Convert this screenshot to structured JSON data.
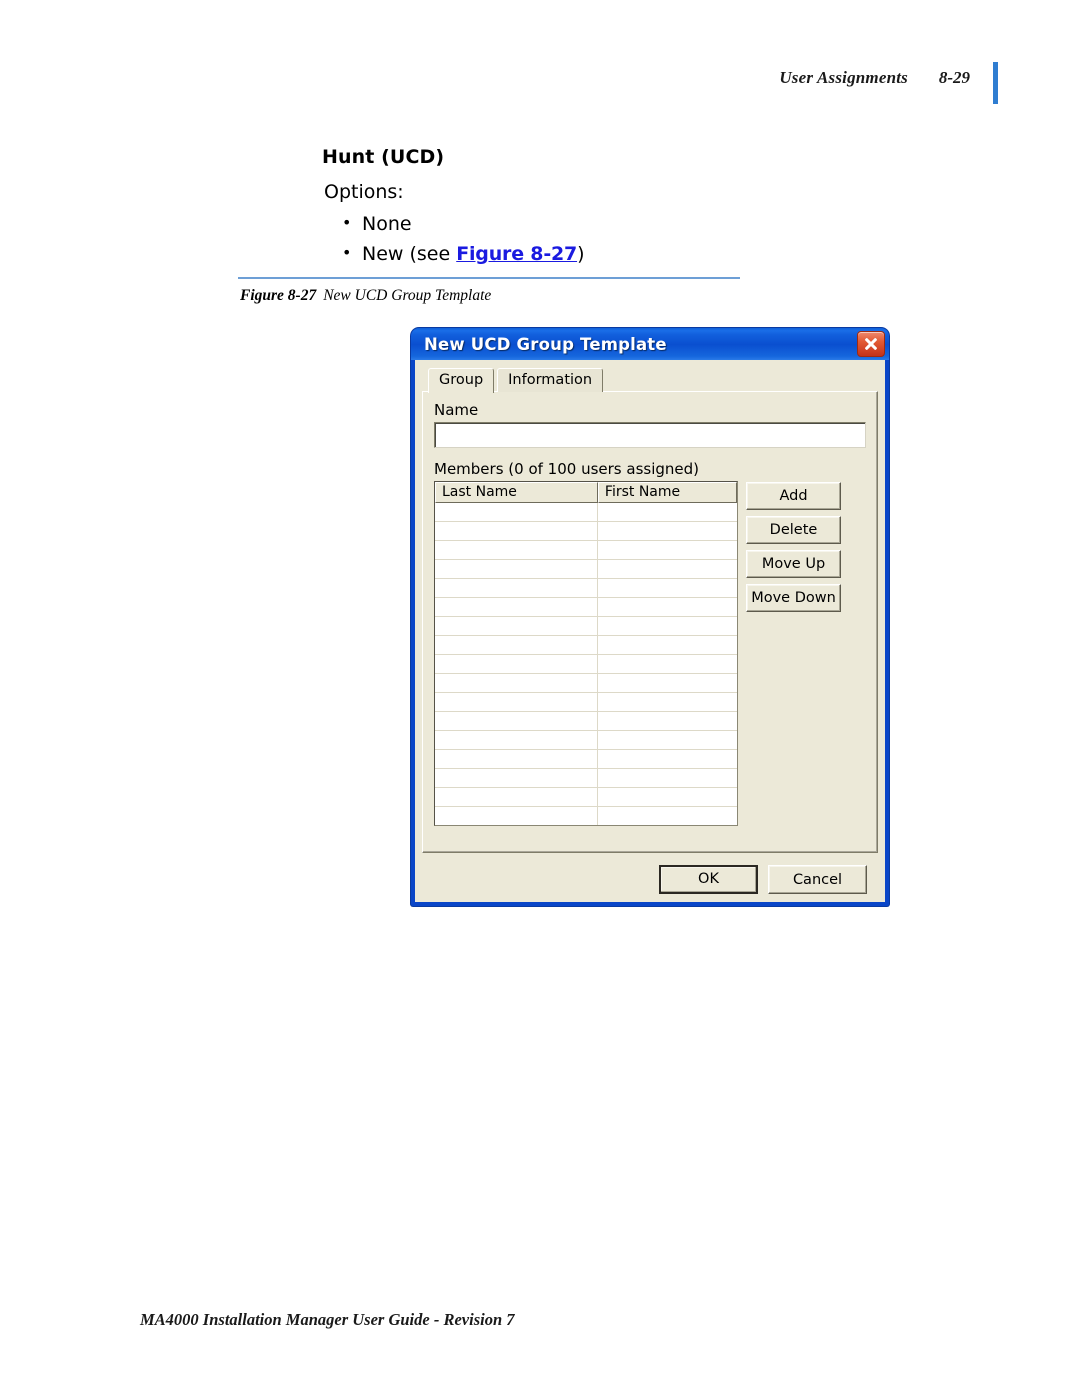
{
  "header": {
    "title": "User Assignments",
    "page_number": "8-29",
    "marker_color": "#2f7dd1"
  },
  "content": {
    "section_title": "Hunt (UCD)",
    "options_label": "Options:",
    "options": [
      {
        "text": "None"
      },
      {
        "text_before": "New (see ",
        "link": "Figure 8-27",
        "text_after": ")"
      }
    ]
  },
  "figure": {
    "label": "Figure 8-27",
    "caption": "New UCD Group Template"
  },
  "dialog": {
    "title": "New UCD Group Template",
    "close_icon": "close-icon",
    "tabs": [
      {
        "label": "Group",
        "active": true
      },
      {
        "label": "Information",
        "active": false
      }
    ],
    "name_label": "Name",
    "name_value": "",
    "name_placeholder": "",
    "members_label": "Members (0 of 100 users assigned)",
    "grid": {
      "columns": [
        "Last Name",
        "First Name"
      ],
      "rows": [],
      "empty_row_count": 17
    },
    "side_buttons": [
      "Add",
      "Delete",
      "Move Up",
      "Move Down"
    ],
    "footer_buttons": [
      {
        "label": "OK",
        "default": true
      },
      {
        "label": "Cancel",
        "default": false
      }
    ]
  },
  "footer": {
    "text": "MA4000 Installation Manager User Guide - Revision 7"
  }
}
